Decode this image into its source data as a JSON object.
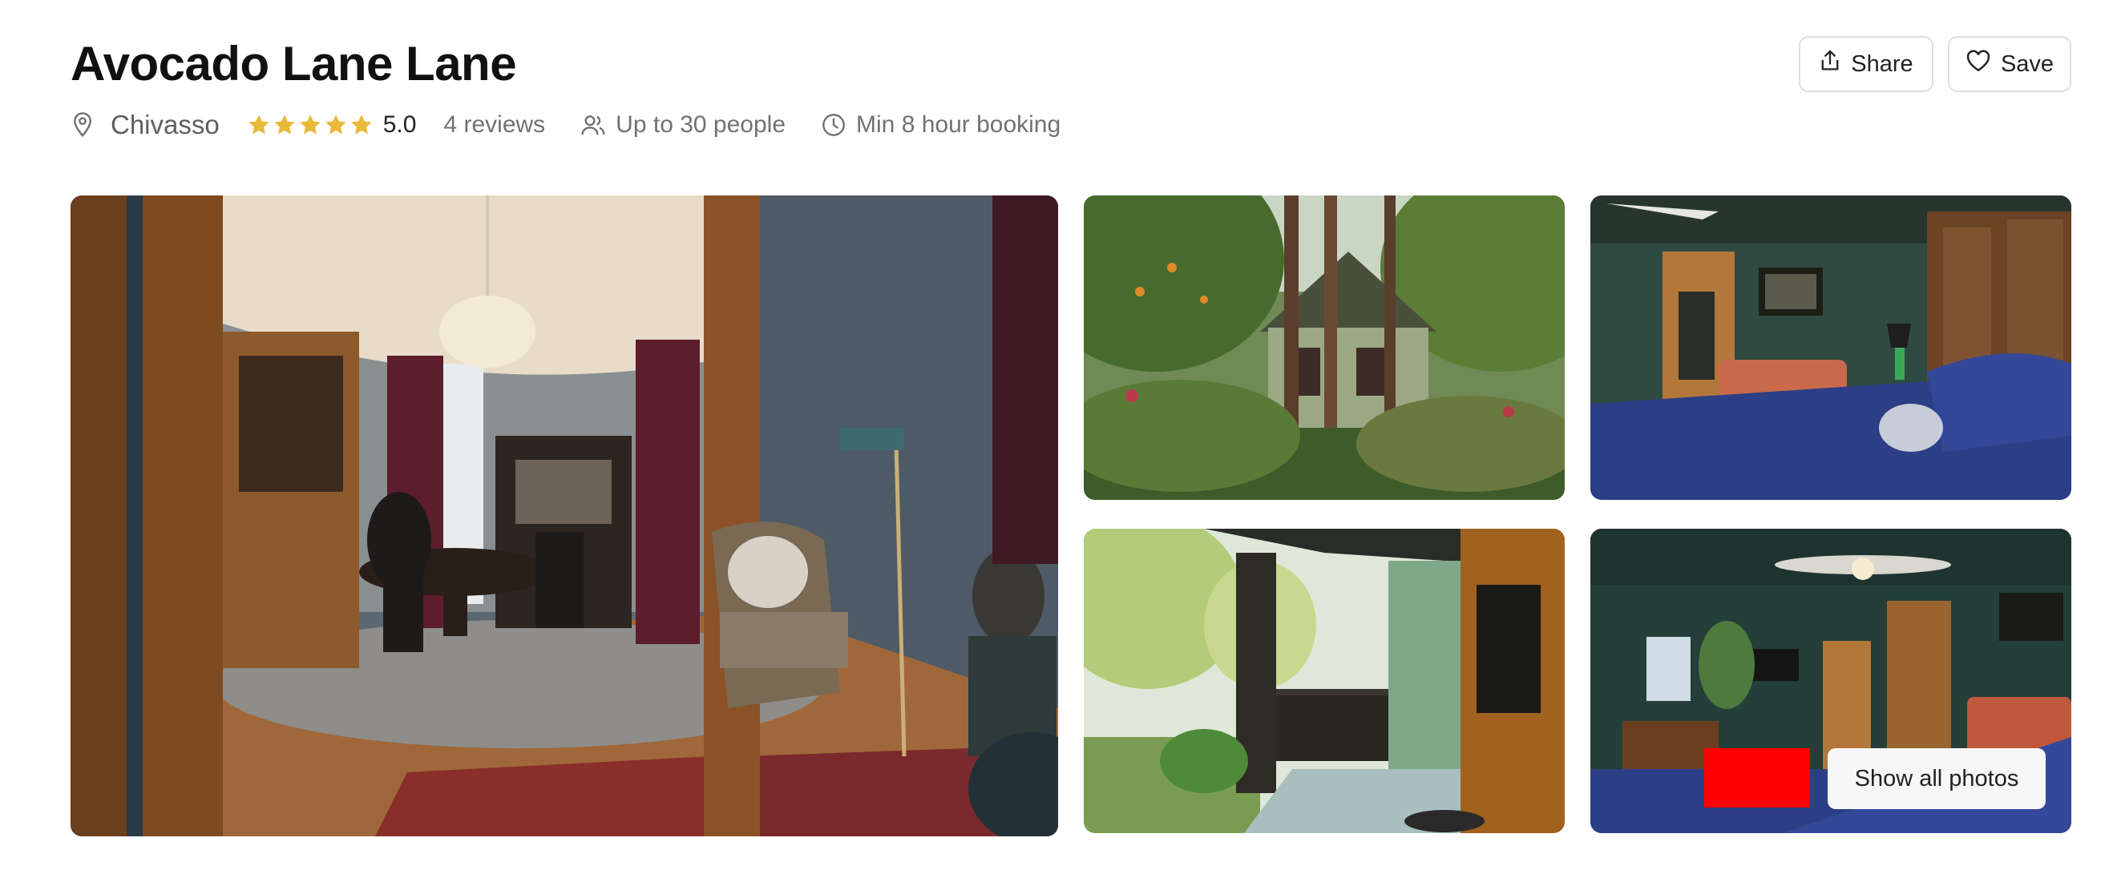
{
  "listing": {
    "title": "Avocado Lane Lane",
    "location": "Chivasso",
    "rating": "5.0",
    "star_count": 5,
    "reviews": "4 reviews",
    "capacity": "Up to 30 people",
    "min_booking": "Min 8 hour booking"
  },
  "actions": {
    "share_label": "Share",
    "save_label": "Save"
  },
  "gallery": {
    "photos": [
      {
        "alt": "Dining room with chandelier, wooden cabinet and armchair"
      },
      {
        "alt": "Green Victorian house behind trees and garden"
      },
      {
        "alt": "Green bedroom with blue bed and orange sofa"
      },
      {
        "alt": "Covered front porch with wooden door"
      },
      {
        "alt": "Dark green bedroom with ceiling fan"
      }
    ],
    "show_all_label": "Show all photos"
  },
  "colors": {
    "star": "#E9B93A",
    "text_primary": "#222222",
    "text_secondary": "#717171",
    "border": "#DDDDDD",
    "overlay_marker": "#FF0000"
  },
  "icons": {
    "location": "map-pin-icon",
    "star": "star-icon",
    "people": "people-icon",
    "clock": "clock-icon",
    "share": "share-icon",
    "save": "heart-icon"
  }
}
